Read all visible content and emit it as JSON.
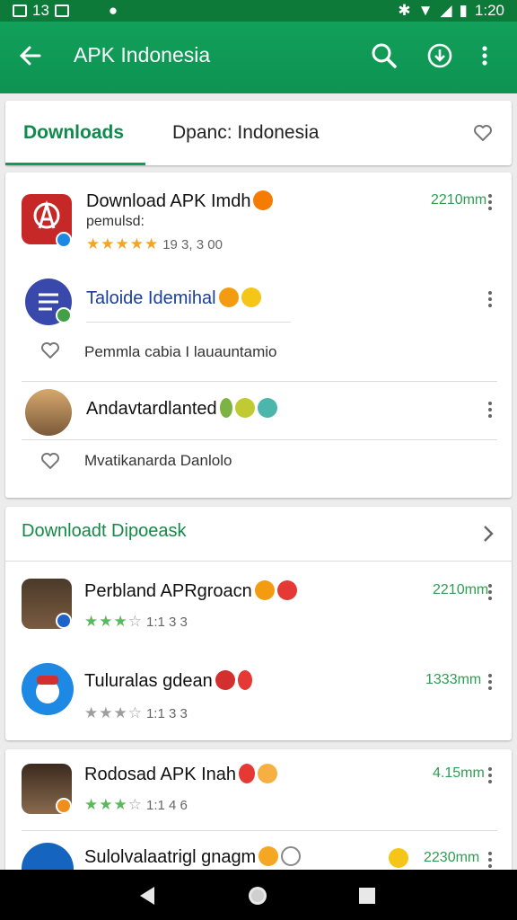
{
  "status": {
    "notif_count": "13",
    "time": "1:20"
  },
  "appbar": {
    "title": "APK Indonesia",
    "icons": [
      "back-arrow-icon",
      "search-icon",
      "download-icon",
      "more-vert-icon"
    ]
  },
  "tabs": {
    "active": "Downloads",
    "other": "Dpanc: Indonesia"
  },
  "card1": {
    "items": [
      {
        "name": "Download APK Imdh",
        "publisher": "pemulsd:",
        "rating_text": "19 3, 3 00",
        "size": "2210mm",
        "stars": 5
      },
      {
        "name": "Taloide Idemihal",
        "sub": "Pemmla cabia I lauauntamio"
      },
      {
        "name": "Andavtardlanted",
        "sub": "Mvatikanarda Danlolo"
      }
    ]
  },
  "section2": {
    "title": "Downloadt Dipoeask",
    "items": [
      {
        "name": "Perbland APRgroacn",
        "rating_text": "1:1 3 3",
        "size": "2210mm",
        "stars": 3
      },
      {
        "name": "Tuluralas gdean",
        "rating_text": "1:1 3 3",
        "size": "1333mm",
        "stars": 3
      }
    ]
  },
  "section3": {
    "items": [
      {
        "name": "Rodosad APK Inah",
        "rating_text": "1:1 4 6",
        "size": "4.15mm",
        "stars": 3
      },
      {
        "name": "Sulolvalaatrigl gnagm",
        "size": "2230mm"
      }
    ]
  },
  "colors": {
    "appbar": "#0f9d58",
    "accent_text": "#138a47",
    "star": "#5cb85c"
  }
}
